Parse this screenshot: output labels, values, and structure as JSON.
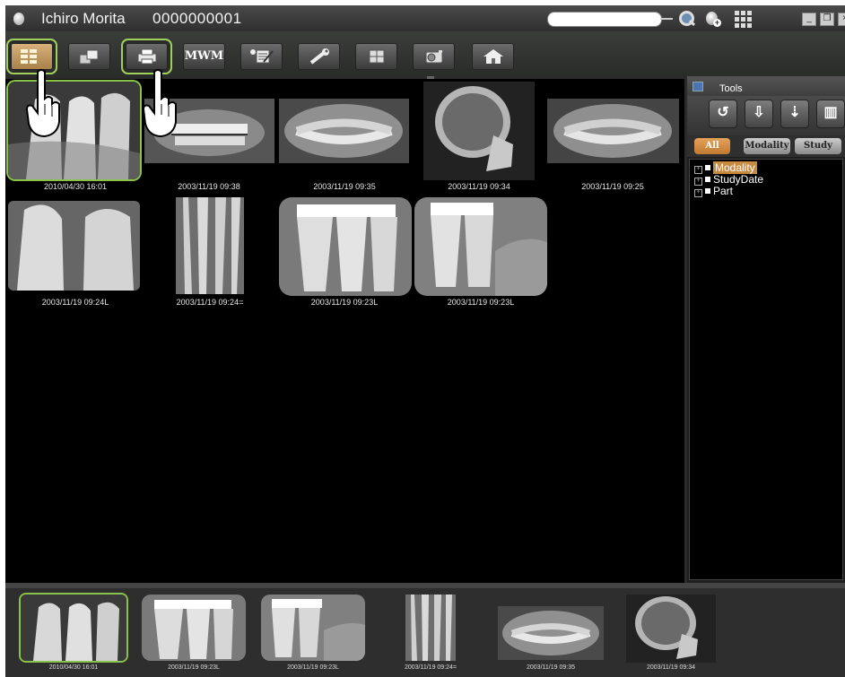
{
  "titlebar": {
    "patient_name": "Ichiro Morita",
    "patient_id": "0000000001",
    "search_value": ""
  },
  "toolbar": {
    "buttons": [
      {
        "name": "image-list-button",
        "icon": "list-grid-icon"
      },
      {
        "name": "window-stack-button",
        "icon": "windows-icon"
      },
      {
        "name": "print-button",
        "icon": "printer-icon"
      },
      {
        "name": "mwm-button",
        "label": "MWM"
      },
      {
        "name": "notes-button",
        "icon": "notepad-icon"
      },
      {
        "name": "settings-button",
        "icon": "wrench-icon"
      },
      {
        "name": "book-button",
        "icon": "book-icon"
      },
      {
        "name": "camera-button",
        "icon": "camera-icon"
      },
      {
        "name": "home-button",
        "icon": "home-icon"
      }
    ]
  },
  "viewer": {
    "row1": [
      {
        "label": "2010/04/30 16:01",
        "kind": "intraoral",
        "selected": true
      },
      {
        "label": "2003/11/19 09:38",
        "kind": "panoramic-front"
      },
      {
        "label": "2003/11/19 09:35",
        "kind": "panoramic"
      },
      {
        "label": "2003/11/19 09:34",
        "kind": "ceph"
      },
      {
        "label": "2003/11/19 09:25",
        "kind": "panoramic"
      }
    ],
    "row2": [
      {
        "label": "2003/11/19 09:24L",
        "kind": "intraoral"
      },
      {
        "label": "2003/11/19 09:24=",
        "kind": "periapical"
      },
      {
        "label": "2003/11/19 09:23L",
        "kind": "bitewing"
      },
      {
        "label": "2003/11/19 09:23L",
        "kind": "bitewing"
      }
    ]
  },
  "tools": {
    "title": "Tools",
    "tabs": {
      "all": "All",
      "modality": "Modality",
      "study": "Study"
    },
    "tree": [
      "Modality",
      "StudyDate",
      "Part"
    ]
  },
  "strip": [
    {
      "label": "2010/04/30 16:01"
    },
    {
      "label": "2003/11/19 09:23L"
    },
    {
      "label": "2003/11/19 09:23L"
    },
    {
      "label": "2003/11/19 09:24="
    },
    {
      "label": "2003/11/19 09:35"
    },
    {
      "label": "2003/11/19 09:34"
    }
  ],
  "colors": {
    "selection": "#8bc34a",
    "accent": "#c88a3e",
    "background": "#000000"
  }
}
